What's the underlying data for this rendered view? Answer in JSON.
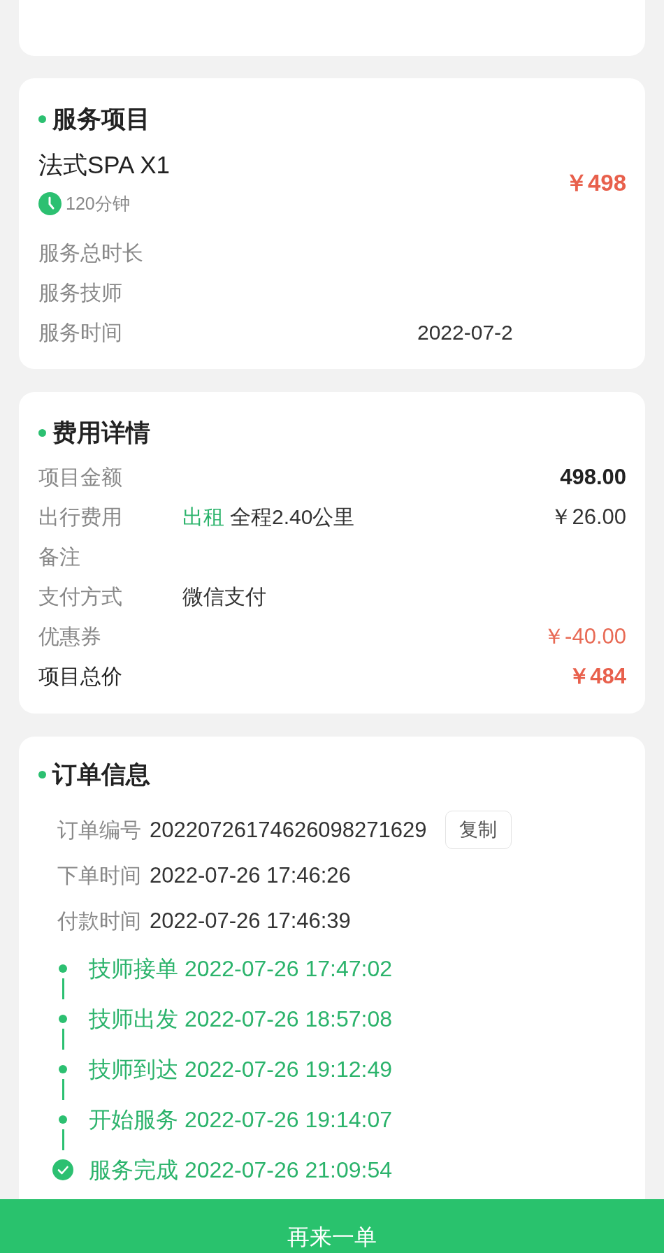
{
  "service": {
    "title": "服务项目",
    "name": "法式SPA X1",
    "duration": "120分钟",
    "price": "￥498",
    "rows": [
      {
        "label": "服务总时长"
      },
      {
        "label": "服务技师"
      },
      {
        "label": "服务时间",
        "value": "2022-07-2"
      }
    ]
  },
  "fees": {
    "title": "费用详情",
    "rows": [
      {
        "kind": "subtotal",
        "label": "项目金额",
        "amount": "498.00"
      },
      {
        "kind": "plain",
        "label": "出行费用",
        "tag": "出租",
        "detail": "全程2.40公里",
        "amount": "￥26.00"
      },
      {
        "kind": "plain",
        "label": "备注"
      },
      {
        "kind": "plain",
        "label": "支付方式",
        "detail": "微信支付"
      },
      {
        "kind": "discount",
        "label": "优惠券",
        "amount": "￥-40.00"
      },
      {
        "kind": "total",
        "label": "项目总价",
        "amount": "￥484"
      }
    ]
  },
  "order": {
    "title": "订单信息",
    "rows": [
      {
        "label": "订单编号",
        "value": "20220726174626098271629",
        "action": "复制"
      },
      {
        "label": "下单时间",
        "value": "2022-07-26 17:46:26"
      },
      {
        "label": "付款时间",
        "value": "2022-07-26 17:46:39"
      }
    ],
    "timeline": [
      {
        "kind": "dot",
        "text": "技师接单 2022-07-26 17:47:02"
      },
      {
        "kind": "dot",
        "text": "技师出发 2022-07-26 18:57:08"
      },
      {
        "kind": "dot",
        "text": "技师到达 2022-07-26 19:12:49"
      },
      {
        "kind": "dot",
        "text": "开始服务 2022-07-26 19:14:07"
      },
      {
        "kind": "check",
        "text": "服务完成 2022-07-26 21:09:54"
      }
    ]
  },
  "bottom_button": {
    "label": "再来一单"
  }
}
